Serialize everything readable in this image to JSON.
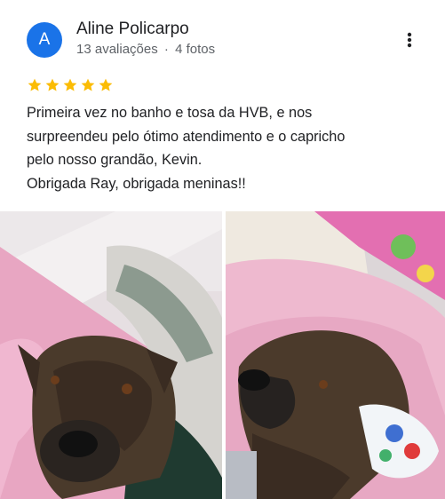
{
  "review": {
    "avatar_initial": "A",
    "reviewer_name": "Aline Policarpo",
    "review_count": "13 avaliações",
    "separator": "·",
    "photo_count": "4 fotos",
    "rating": 5,
    "text_lines": [
      "Primeira vez no banho e tosa da HVB, e nos",
      "surpreendeu pelo ótimo atendimento e o capricho",
      "pelo nosso grandão, Kevin.",
      "Obrigada Ray, obrigada meninas!!"
    ]
  },
  "icons": {
    "more": "more-vert-icon",
    "star": "star-icon"
  },
  "colors": {
    "avatar_bg": "#1a73e8",
    "star": "#fbbc04",
    "secondary_text": "#5f6368"
  }
}
